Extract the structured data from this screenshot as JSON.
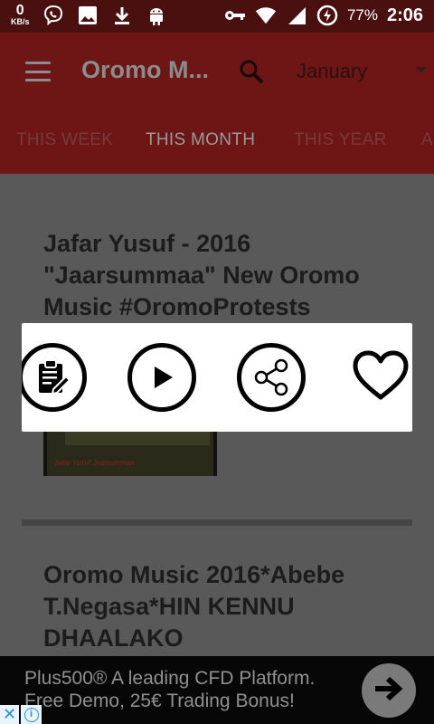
{
  "status_bar": {
    "net_speed": "0",
    "net_unit": "KB/s",
    "battery_percent": "77%",
    "time": "2:06",
    "icons": [
      "viber-icon",
      "gallery-icon",
      "download-icon",
      "android-debug-icon",
      "key-icon",
      "wifi-icon",
      "signal-icon",
      "battery-saver-icon"
    ]
  },
  "app_bar": {
    "title": "Oromo M...",
    "month": "January",
    "tabs": [
      "THIS WEEK",
      "THIS MONTH",
      "THIS YEAR",
      "A"
    ],
    "active_tab": "THIS MONTH"
  },
  "content": {
    "cards": [
      {
        "title": "Jafar Yusuf - 2016 \"Jaarsummaa\" New Oromo Music #OromoProtests",
        "thumb_caption": "Jafar Yusuf Jaarsummaa"
      },
      {
        "title": "Oromo Music 2016*Abebe T.Negasa*HIN KENNU DHAALAKO"
      }
    ]
  },
  "popup": {
    "actions": [
      "notes-icon",
      "play-icon",
      "share-icon",
      "heart-icon"
    ]
  },
  "ad": {
    "line1": "Plus500® A leading CFD Platform.",
    "line2": "Free Demo, 25€ Trading Bonus!",
    "close_glyph": "✕",
    "info_glyph": "i"
  },
  "colors": {
    "status_bar": "#4a1010",
    "app_bar": "#6e1515",
    "content_bg": "#595959",
    "popup_bg": "#ffffff",
    "ad_bg": "#070707"
  }
}
